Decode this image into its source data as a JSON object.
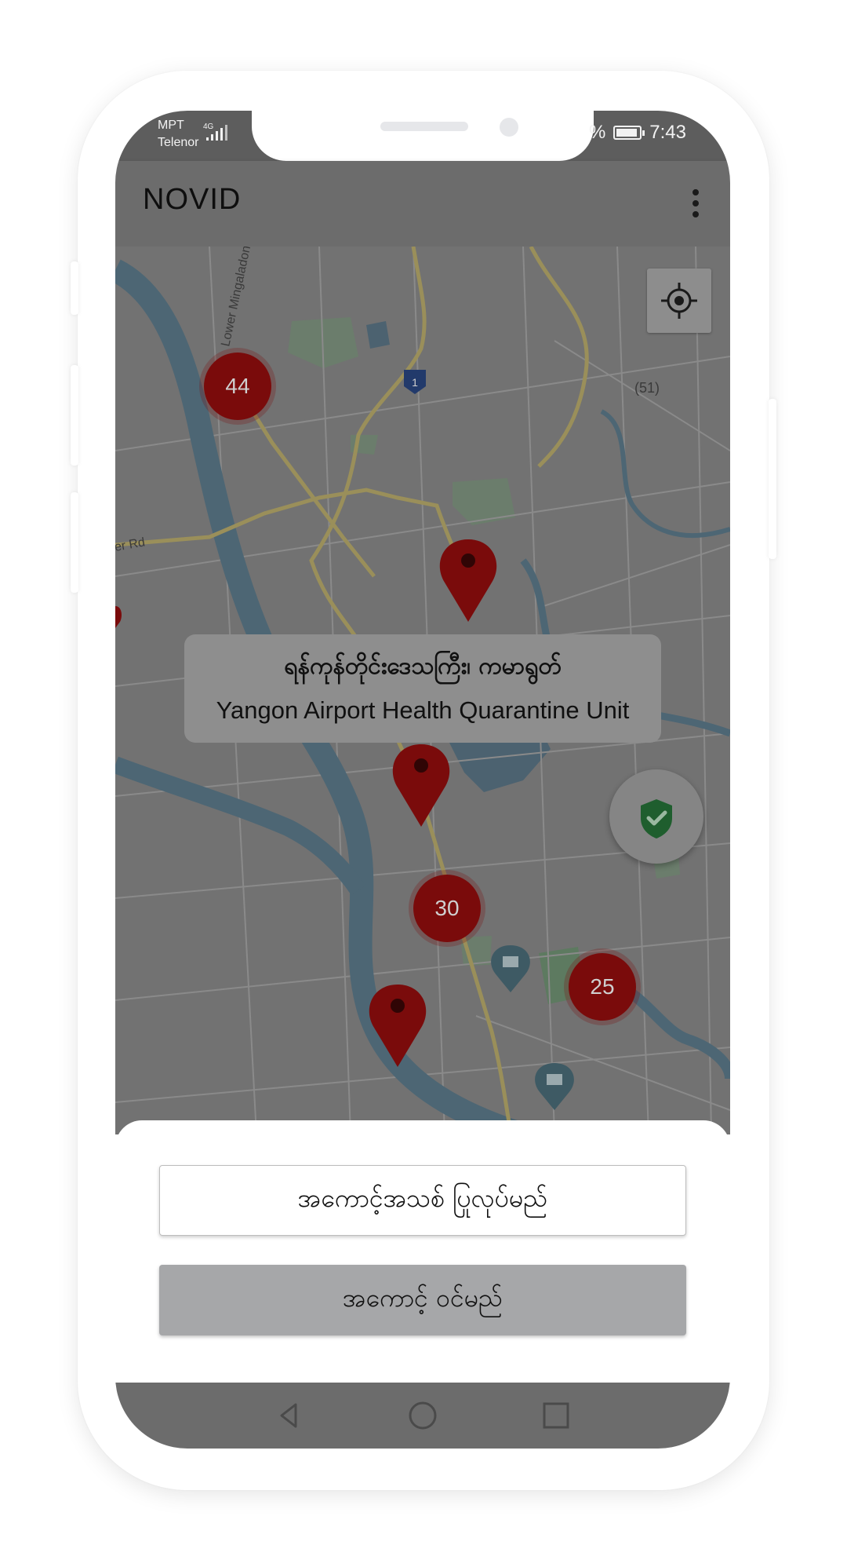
{
  "status_bar": {
    "carrier_1": "MPT",
    "carrier_2": "Telenor",
    "network": "4G",
    "battery_text": "%",
    "time": "7:43"
  },
  "app_bar": {
    "title": "NOVID",
    "menu_icon": "more-vert-icon"
  },
  "map": {
    "road_labels": [
      "Lower Mingaladon",
      "er Rd",
      "(51)"
    ],
    "highway_shield": "1",
    "clusters": [
      {
        "count": "44",
        "color": "#7a0b0b"
      },
      {
        "count": "30",
        "color": "#7a0b0b"
      },
      {
        "count": "25",
        "color": "#7a0b0b"
      }
    ],
    "location_button_icon": "my-location-icon",
    "info_window": {
      "title_my": "ရန်ကုန်တိုင်းဒေသကြီး၊ ကမာရွတ်",
      "title_en": "Yangon Airport Health Quarantine Unit"
    },
    "shield_icon": "shield-check-icon",
    "shield_color": "#1f5e2e"
  },
  "actions": {
    "register_label": "အကောင့်အသစ် ပြုလုပ်မည်",
    "login_label": "အကောင့် ဝင်မည်"
  },
  "nav_bar": {
    "back_icon": "back-triangle-icon",
    "home_icon": "home-circle-icon",
    "recents_icon": "recents-square-icon"
  }
}
